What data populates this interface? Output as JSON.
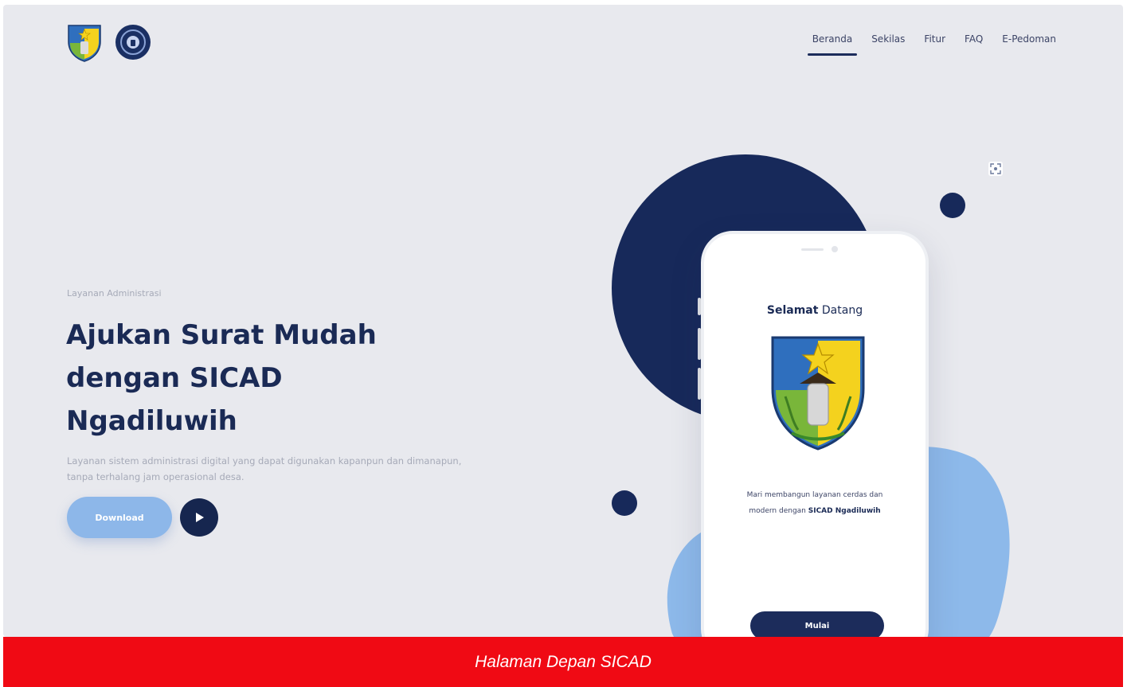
{
  "logos": {
    "crest_alt": "Kabupaten Kediri crest",
    "seal_alt": "Village seal"
  },
  "nav": {
    "items": [
      {
        "label": "Beranda",
        "active": true
      },
      {
        "label": "Sekilas",
        "active": false
      },
      {
        "label": "Fitur",
        "active": false
      },
      {
        "label": "FAQ",
        "active": false
      },
      {
        "label": "E-Pedoman",
        "active": false
      }
    ]
  },
  "hero": {
    "eyebrow": "Layanan Administrasi",
    "title_line_1": "Ajukan Surat Mudah",
    "title_line_2": "dengan SICAD",
    "title_line_3": "Ngadiluwih",
    "description": "Layanan sistem administrasi digital yang dapat digunakan kapanpun dan dimanapun, tanpa terhalang jam operasional desa.",
    "download_label": "Download",
    "play_icon": "play-icon"
  },
  "phone": {
    "welcome_part_1": "Selamat",
    "welcome_part_2": " Datang",
    "text_line_1": "Mari membangun layanan cerdas dan",
    "text_line_2_prefix": "modern dengan ",
    "text_line_2_bold": "SICAD Ngadiluwih",
    "start_label": "Mulai"
  },
  "caption": {
    "text": "Halaman Depan SICAD"
  },
  "colors": {
    "navy": "#17295a",
    "light_blue": "#8db7e9",
    "background": "#e8e9ee",
    "caption_red": "#f00a14"
  }
}
